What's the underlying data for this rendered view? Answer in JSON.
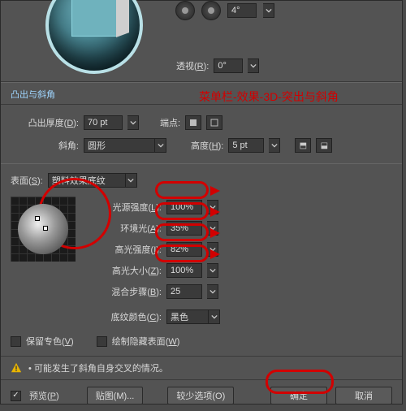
{
  "top": {
    "angle_value": "4°",
    "perspective_label": "透视",
    "perspective_key": "R",
    "perspective_value": "0°"
  },
  "section1": {
    "title": "凸出与斜角",
    "extrude_label": "凸出厚度",
    "extrude_key": "D",
    "extrude_value": "70 pt",
    "cap_label": "端点:",
    "bevel_label": "斜角:",
    "bevel_value": "圆形",
    "height_label": "高度",
    "height_key": "H",
    "height_value": "5 pt"
  },
  "surface": {
    "label": "表面",
    "key": "S",
    "value": "塑料效果底纹",
    "sliders": [
      {
        "label": "光源强度",
        "key": "L",
        "value": "100%"
      },
      {
        "label": "环境光",
        "key": "A",
        "value": "35%"
      },
      {
        "label": "高光强度",
        "key": "I",
        "value": "82%"
      },
      {
        "label": "高光大小",
        "key": "Z",
        "value": "100%"
      }
    ],
    "blend_label": "混合步骤",
    "blend_key": "B",
    "blend_value": "25",
    "shade_label": "底纹颜色",
    "shade_key": "C",
    "shade_value": "黑色",
    "preserve_spot_label": "保留专色",
    "preserve_spot_key": "V",
    "draw_hidden_label": "绘制隐藏表面",
    "draw_hidden_key": "W"
  },
  "warning": "可能发生了斜角自身交叉的情况。",
  "footer": {
    "preview_label": "预览",
    "preview_key": "P",
    "map_art": "贴图(M)...",
    "fewer": "较少选项(O)",
    "ok": "确定",
    "cancel": "取消"
  },
  "annotation": "菜单栏-效果-3D-突出与斜角"
}
